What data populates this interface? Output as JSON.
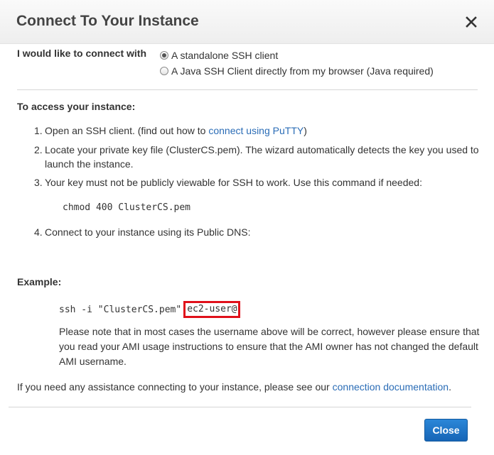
{
  "dialog": {
    "title": "Connect To Your Instance"
  },
  "connect_with": {
    "label": "I would like to connect with",
    "options": [
      {
        "label": "A standalone SSH client",
        "selected": true
      },
      {
        "label": "A Java SSH Client directly from my browser (Java required)",
        "selected": false
      }
    ]
  },
  "access": {
    "title": "To access your instance:",
    "steps": [
      {
        "num": "1.",
        "pre": "Open an SSH client. (find out how to ",
        "link": "connect using PuTTY",
        "post": ")"
      },
      {
        "num": "2.",
        "text": "Locate your private key file (ClusterCS.pem). The wizard automatically detects the key you used to launch the instance."
      },
      {
        "num": "3.",
        "text": "Your key must not be publicly viewable for SSH to work. Use this command if needed:"
      },
      {
        "num": "4.",
        "text": "Connect to your instance using its Public DNS:"
      }
    ],
    "chmod_command": "chmod 400 ClusterCS.pem"
  },
  "example": {
    "title": "Example:",
    "command_prefix": "ssh -i \"ClusterCS.pem\"",
    "command_user": "ec2-user@",
    "note": "Please note that in most cases the username above will be correct, however please ensure that you read your AMI usage instructions to ensure that the AMI owner has not changed the default AMI username."
  },
  "help": {
    "text": "If you need any assistance connecting to your instance, please see our ",
    "link": "connection documentation",
    "post": "."
  },
  "footer": {
    "close_label": "Close"
  },
  "colors": {
    "link": "#2a6cb6",
    "primary_button": "#1f74c6",
    "highlight_box": "#e0101a"
  }
}
